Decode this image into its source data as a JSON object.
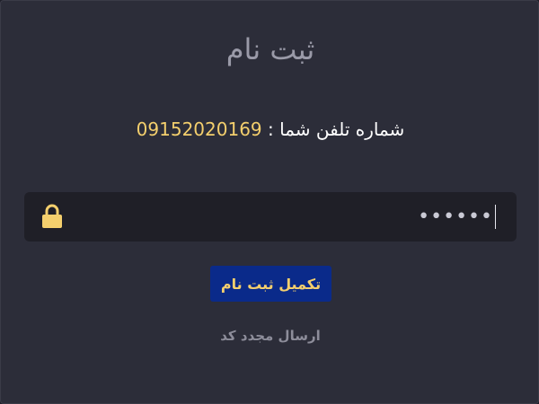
{
  "form": {
    "title": "ثبت نام",
    "phone_label": "شماره تلفن شما : ",
    "phone_number": "09152020169",
    "password_value": "••••••",
    "lock_icon": "lock-icon",
    "submit_label": "تکمیل ثبت نام",
    "resend_label": "ارسال مجدد کد"
  },
  "colors": {
    "background": "#2c2d39",
    "input_background": "#1f1f27",
    "accent_yellow": "#f4cf6d",
    "button_blue": "#0a2a8a",
    "muted_text": "#8d8d9a"
  }
}
